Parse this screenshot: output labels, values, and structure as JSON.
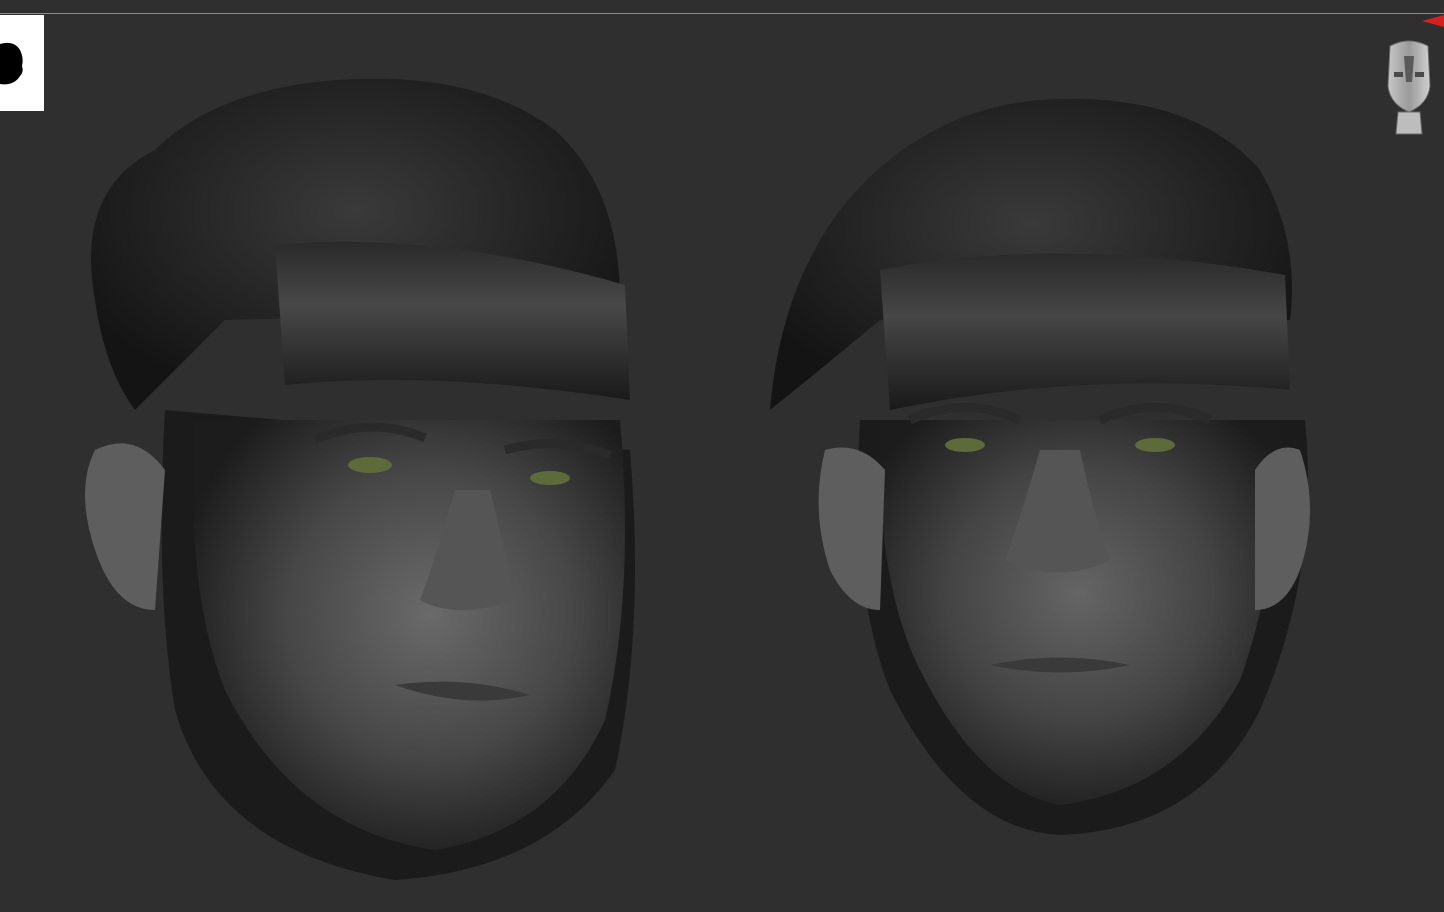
{
  "app": {
    "background_color": "#2f2f2f",
    "top_line_color": "#8a8a8a"
  },
  "toolbar": {
    "mode_icon": "head-silhouette-icon",
    "nav_gizmo_icon": "navigation-head-gizmo-icon",
    "marker_icon": "red-arrow-marker-icon"
  },
  "viewport": {
    "objects": [
      {
        "name": "head-sculpt-left",
        "icon": "sculpt-head-3-4-view"
      },
      {
        "name": "head-sculpt-right",
        "icon": "sculpt-head-front-view"
      }
    ],
    "accent_colors": {
      "eye": "#5f6a3a",
      "marker": "#d42020"
    }
  }
}
